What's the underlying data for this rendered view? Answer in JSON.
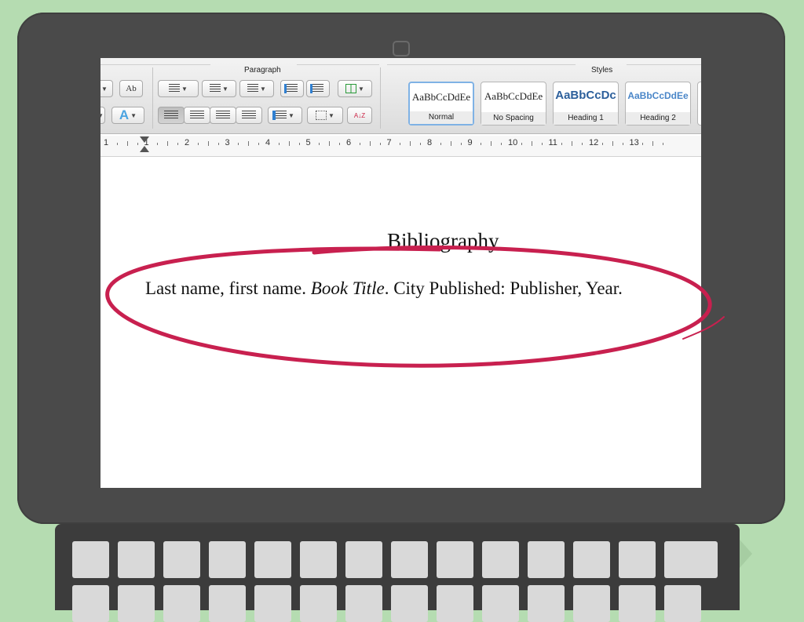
{
  "ribbon": {
    "paragraph_label": "Paragraph",
    "styles_label": "Styles",
    "styles": [
      {
        "sample": "AaBbCcDdEe",
        "name": "Normal",
        "selected": true
      },
      {
        "sample": "AaBbCcDdEe",
        "name": "No Spacing",
        "selected": false
      },
      {
        "sample": "AaBbCcDc",
        "name": "Heading 1",
        "selected": false
      },
      {
        "sample": "AaBbCcDdEe",
        "name": "Heading 2",
        "selected": false
      }
    ],
    "spellcheck_glyph": "Ab",
    "text_effects_glyph": "A",
    "sort_glyph": "A↓Z"
  },
  "ruler": {
    "numbers": [
      "1",
      "1",
      "2",
      "3",
      "4",
      "5",
      "6",
      "7",
      "8",
      "9",
      "10",
      "11",
      "12",
      "13"
    ]
  },
  "document": {
    "heading": "Bibliography",
    "entry_author": "Last name, first name. ",
    "entry_title": "Book Title",
    "entry_rest": ". City Published: Publisher, Year."
  },
  "colors": {
    "background": "#b5dcb1",
    "laptop": "#4a4a4a",
    "highlight_ellipse": "#c8204f",
    "heading1_blue": "#2c5f9b",
    "heading2_blue": "#4a86c8"
  }
}
